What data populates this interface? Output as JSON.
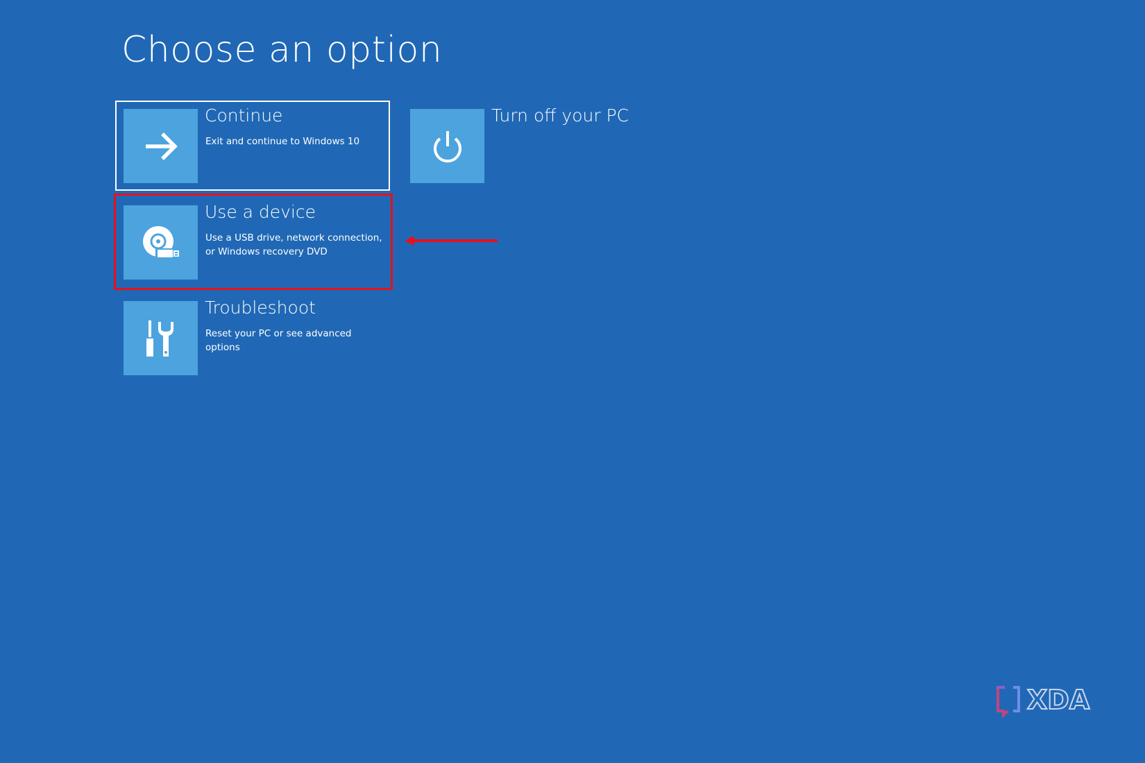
{
  "page": {
    "title": "Choose an option"
  },
  "options": [
    {
      "title": "Continue",
      "description": "Exit and continue to Windows 10",
      "icon": "arrow-right-icon",
      "selected": true
    },
    {
      "title": "Turn off your PC",
      "description": "",
      "icon": "power-icon",
      "selected": false
    },
    {
      "title": "Use a device",
      "description": "Use a USB drive, network connection, or Windows recovery DVD",
      "icon": "disc-usb-icon",
      "selected": false
    },
    {
      "title": "Troubleshoot",
      "description": "Reset your PC or see advanced options",
      "icon": "tools-icon",
      "selected": false
    }
  ],
  "annotation": {
    "color": "#e8101a"
  },
  "watermark": {
    "text": "XDA"
  },
  "colors": {
    "background": "#2068b5",
    "tile": "#4ca3de",
    "text": "#ffffff"
  }
}
